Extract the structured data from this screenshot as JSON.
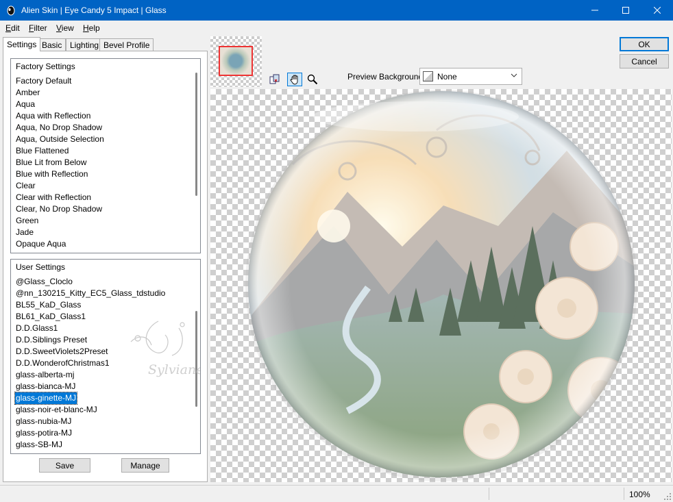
{
  "window": {
    "title": "Alien Skin | Eye Candy 5 Impact | Glass",
    "titlebar_color": "#0063c4",
    "controls": {
      "minimize": "minimize-icon",
      "maximize": "maximize-icon",
      "close": "close-icon"
    }
  },
  "menu": [
    {
      "label": "Edit",
      "hotkey": "E",
      "rest": "dit"
    },
    {
      "label": "Filter",
      "hotkey": "F",
      "rest": "ilter"
    },
    {
      "label": "View",
      "hotkey": "V",
      "rest": "iew"
    },
    {
      "label": "Help",
      "hotkey": "H",
      "rest": "elp"
    }
  ],
  "tabs": [
    "Settings",
    "Basic",
    "Lighting",
    "Bevel Profile"
  ],
  "factory_settings": {
    "header": "Factory Settings",
    "items": [
      "Factory Default",
      "Amber",
      "Aqua",
      "Aqua with Reflection",
      "Aqua, No Drop Shadow",
      "Aqua, Outside Selection",
      "Blue Flattened",
      "Blue Lit from Below",
      "Blue with Reflection",
      "Clear",
      "Clear with Reflection",
      "Clear, No Drop Shadow",
      "Green",
      "Jade",
      "Opaque Aqua"
    ]
  },
  "user_settings": {
    "header": "User Settings",
    "items": [
      "@Glass_Cloclo",
      "@nn_130215_Kitty_EC5_Glass_tdstudio",
      "BL55_KaD_Glass",
      "BL61_KaD_Glass1",
      "D.D.Glass1",
      "D.D.Siblings Preset",
      "D.D.SweetViolets2Preset",
      "D.D.WonderofChristmas1",
      "glass-alberta-mj",
      "glass-bianca-MJ",
      "glass-ginette-MJ",
      "glass-noir-et-blanc-MJ",
      "glass-nubia-MJ",
      "glass-potira-MJ",
      "glass-SB-MJ"
    ],
    "selected": "glass-ginette-MJ",
    "watermark": "Sylviane"
  },
  "buttons": {
    "save": "Save",
    "manage": "Manage",
    "ok": "OK",
    "cancel": "Cancel"
  },
  "preview_background": {
    "label": "Preview Background:",
    "value": "None"
  },
  "tools": [
    "copy-to-clipboard-icon",
    "hand-pan-icon",
    "zoom-icon"
  ],
  "status": {
    "zoom": "100%"
  },
  "colors": {
    "selection": "#0078d7",
    "accent": "#0078d7"
  }
}
